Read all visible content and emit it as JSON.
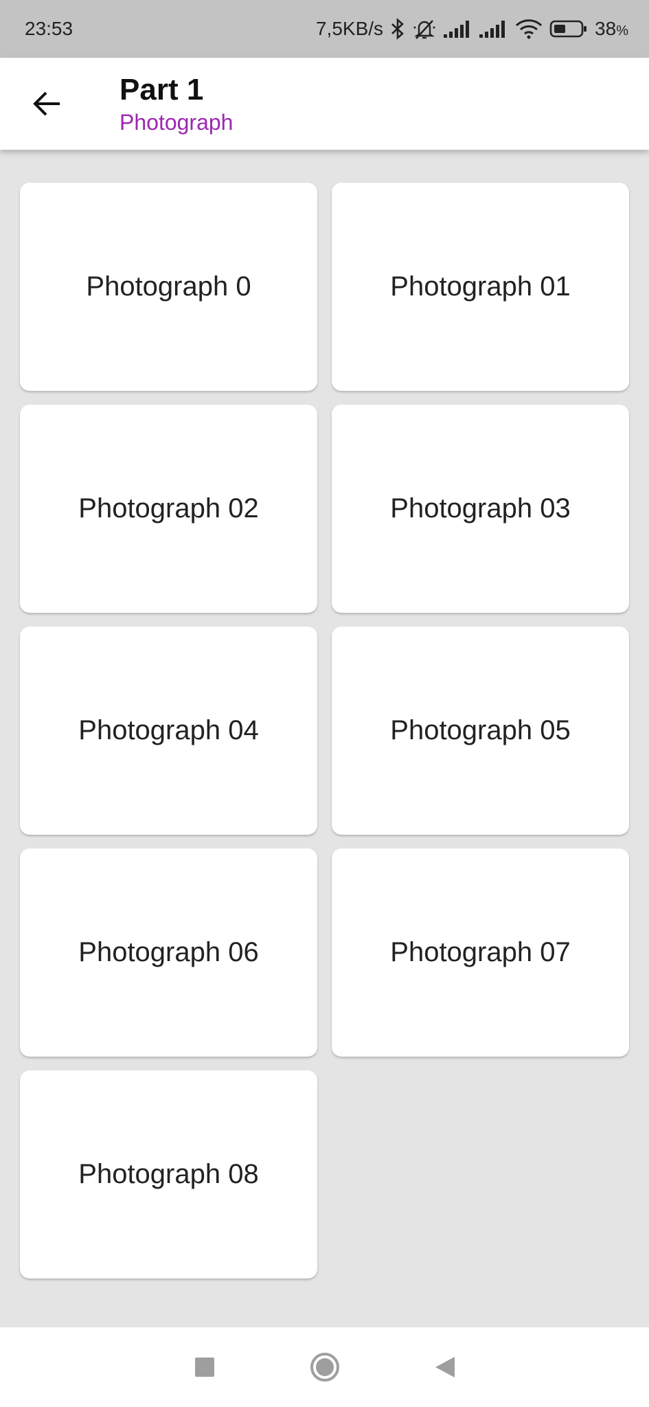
{
  "status_bar": {
    "time": "23:53",
    "network_speed": "7,5KB/s",
    "battery": "38",
    "battery_unit": "%",
    "icons": [
      "bluetooth-icon",
      "mute-icon",
      "signal-icon",
      "signal-icon",
      "wifi-icon",
      "battery-icon"
    ]
  },
  "app_bar": {
    "title": "Part 1",
    "subtitle": "Photograph",
    "subtitle_color": "#9c27b0",
    "back_icon": "arrow-back-icon"
  },
  "grid": {
    "items": [
      {
        "label": "Photograph 0"
      },
      {
        "label": "Photograph 01"
      },
      {
        "label": "Photograph 02"
      },
      {
        "label": "Photograph 03"
      },
      {
        "label": "Photograph 04"
      },
      {
        "label": "Photograph 05"
      },
      {
        "label": "Photograph 06"
      },
      {
        "label": "Photograph 07"
      },
      {
        "label": "Photograph 08"
      }
    ]
  },
  "nav_bar": {
    "icons": [
      "recents-square-icon",
      "home-circle-icon",
      "back-triangle-icon"
    ]
  }
}
